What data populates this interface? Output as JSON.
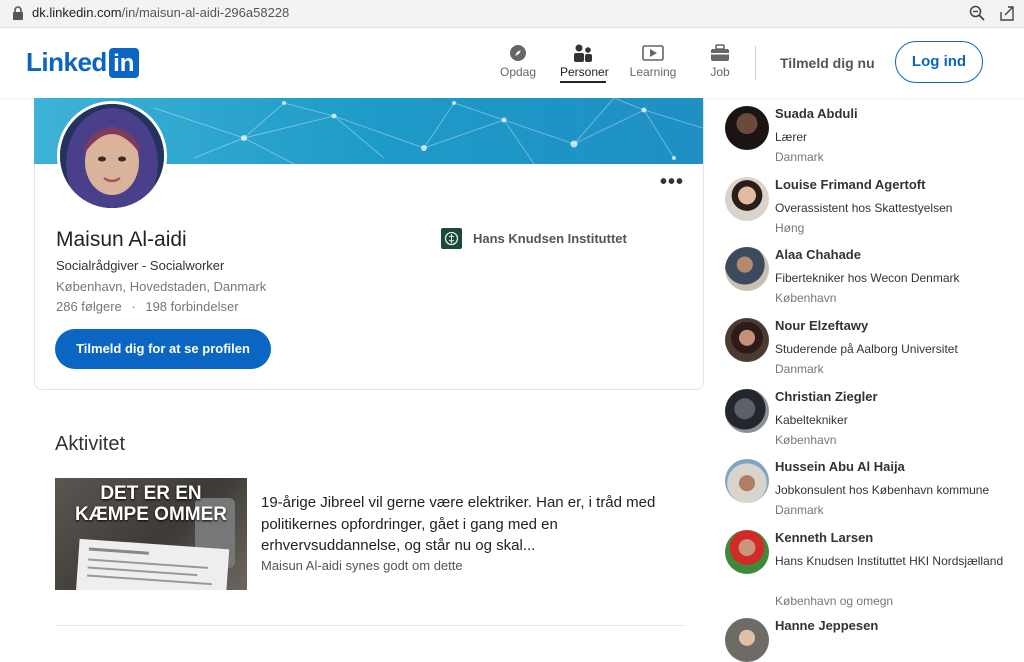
{
  "browser": {
    "url_host": "dk.linkedin.com",
    "url_path": "/in/maisun-al-aidi-296a58228"
  },
  "nav": {
    "logo_word": "Linked",
    "logo_box": "in",
    "items": [
      {
        "label": "Opdag",
        "icon": "compass-icon"
      },
      {
        "label": "Personer",
        "icon": "people-icon"
      },
      {
        "label": "Learning",
        "icon": "video-play-icon"
      },
      {
        "label": "Job",
        "icon": "briefcase-icon"
      }
    ],
    "join_label": "Tilmeld dig nu",
    "login_label": "Log ind"
  },
  "profile": {
    "name": "Maisun Al-aidi",
    "headline": "Socialrådgiver - Socialworker",
    "location": "København, Hovedstaden, Danmark",
    "followers": "286 følgere",
    "connections": "198 forbindelser",
    "company": "Hans Knudsen Instituttet",
    "cta_label": "Tilmeld dig for at se profilen",
    "more_label": "•••"
  },
  "activity": {
    "title": "Aktivitet",
    "post_image_text_1": "DET ER EN",
    "post_image_text_2": "KÆMPE OMMER",
    "post_text": "19-årige Jibreel vil gerne være elektriker. Han er, i tråd med politikernes opfordringer, gået i gang med en erhvervsuddannelse, og står nu og skal...",
    "post_meta": "Maisun Al-aidi synes godt om dette"
  },
  "people": [
    {
      "name": "Suada Abduli",
      "role": "Lærer",
      "location": "Danmark"
    },
    {
      "name": "Louise Frimand Agertoft",
      "role": "Overassistent hos Skattestyelsen",
      "location": "Høng"
    },
    {
      "name": "Alaa Chahade",
      "role": "Fibertekniker hos Wecon Denmark",
      "location": "København"
    },
    {
      "name": "Nour Elzeftawy",
      "role": "Studerende på Aalborg Universitet",
      "location": "Danmark"
    },
    {
      "name": "Christian Ziegler",
      "role": "Kabeltekniker",
      "location": "København"
    },
    {
      "name": "Hussein Abu Al Haija",
      "role": "Jobkonsulent hos København kommune",
      "location": "Danmark"
    },
    {
      "name": "Kenneth Larsen",
      "role": "Hans Knudsen Instituttet HKI Nordsjælland",
      "location": "København og omegn"
    },
    {
      "name": "Hanne Jeppesen",
      "role": "",
      "location": ""
    }
  ],
  "colors": {
    "brand": "#0a66c2"
  }
}
